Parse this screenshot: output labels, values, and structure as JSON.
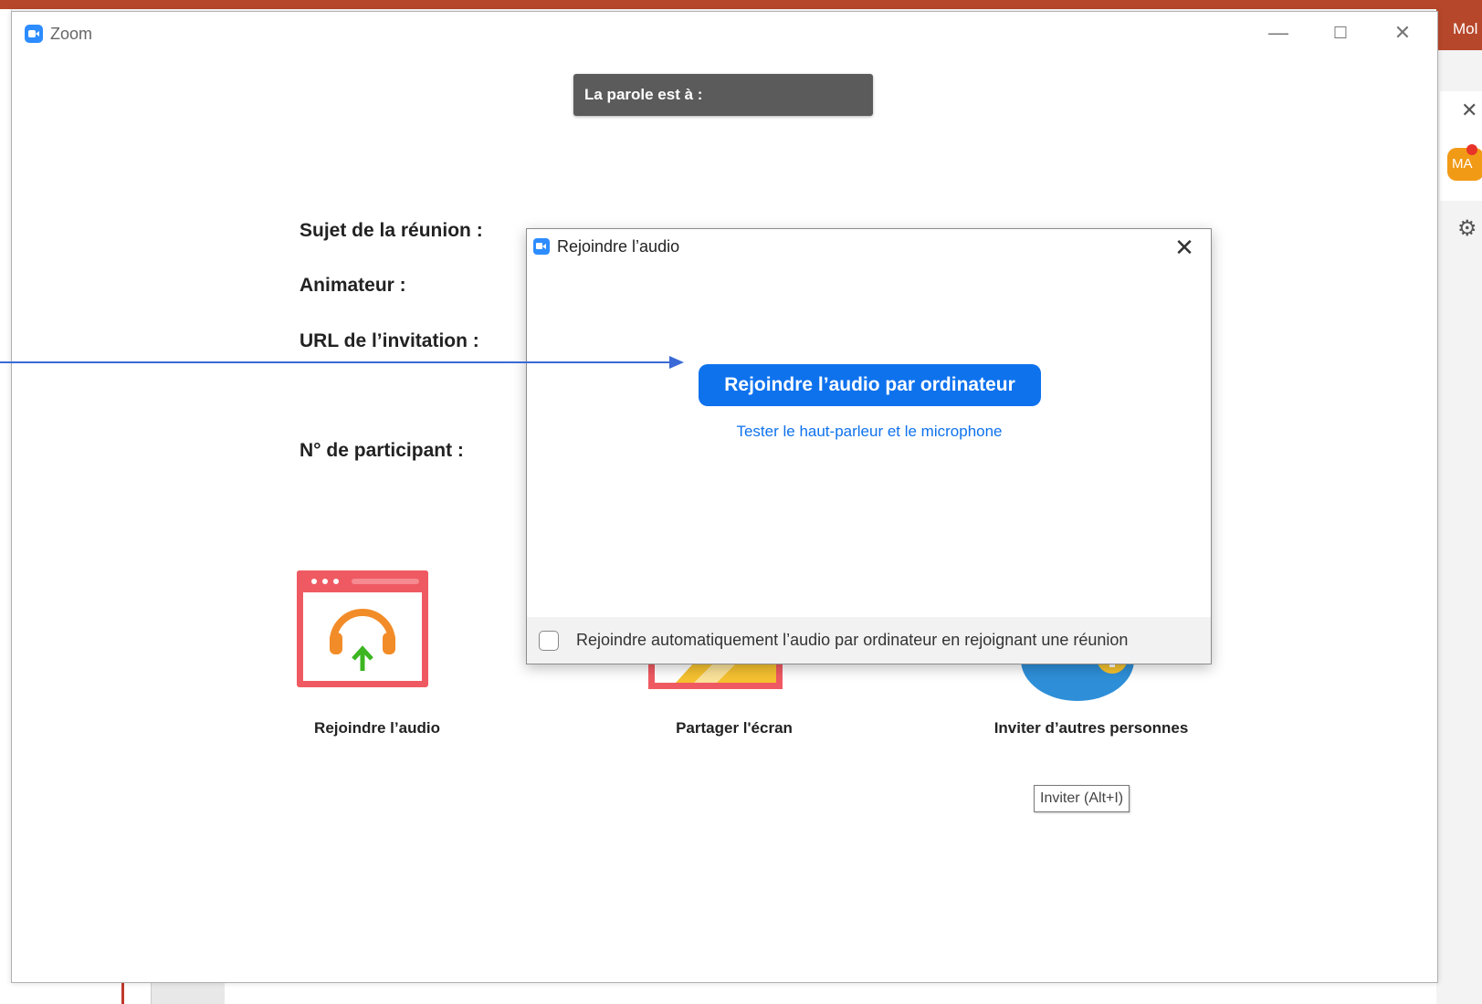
{
  "background": {
    "right_bar_text": "Mol",
    "avatar_initials": "MA"
  },
  "window": {
    "title": "Zoom",
    "minimize": "—",
    "maximize": "☐",
    "close": "✕"
  },
  "speaker_banner": "La parole est à :",
  "meeting_info": {
    "topic_label": "Sujet de la réunion :",
    "host_label": "Animateur :",
    "invite_url_label": "URL de l’invitation :",
    "participant_id_label": "N° de participant :"
  },
  "features": {
    "join_audio": "Rejoindre l’audio",
    "share_screen": "Partager l'écran",
    "invite_others": "Inviter d’autres personnes"
  },
  "tooltip": "Inviter (Alt+I)",
  "dialog": {
    "title": "Rejoindre l’audio",
    "close": "✕",
    "primary_button": "Rejoindre l’audio par ordinateur",
    "test_link": "Tester le haut-parleur et le microphone",
    "auto_join_label": "Rejoindre automatiquement l’audio par ordinateur en rejoignant une réunion",
    "auto_join_checked": false
  },
  "colors": {
    "accent": "#0e72ed",
    "banner": "#5b5b5b",
    "annotation_arrow": "#3a6ad6"
  }
}
